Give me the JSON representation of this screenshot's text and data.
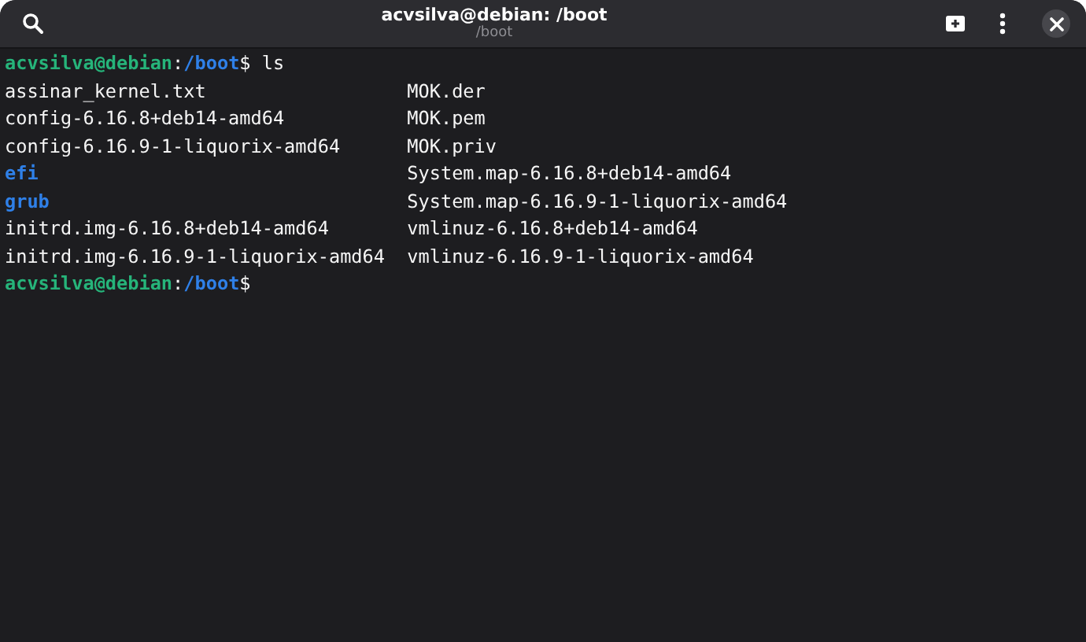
{
  "window": {
    "title": "acvsilva@debian: /boot",
    "subtitle": "/boot"
  },
  "terminal": {
    "lines": [
      {
        "kind": "prompt",
        "user_host": "acvsilva@debian",
        "separator": ":",
        "path": "/boot",
        "symbol": "$",
        "command": "ls"
      },
      {
        "kind": "listing",
        "rows": [
          [
            {
              "name": "assinar_kernel.txt",
              "kind": "file"
            },
            {
              "name": "MOK.der",
              "kind": "file"
            }
          ],
          [
            {
              "name": "config-6.16.8+deb14-amd64",
              "kind": "file"
            },
            {
              "name": "MOK.pem",
              "kind": "file"
            }
          ],
          [
            {
              "name": "config-6.16.9-1-liquorix-amd64",
              "kind": "file"
            },
            {
              "name": "MOK.priv",
              "kind": "file"
            }
          ],
          [
            {
              "name": "efi",
              "kind": "directory"
            },
            {
              "name": "System.map-6.16.8+deb14-amd64",
              "kind": "file"
            }
          ],
          [
            {
              "name": "grub",
              "kind": "directory"
            },
            {
              "name": "System.map-6.16.9-1-liquorix-amd64",
              "kind": "file"
            }
          ],
          [
            {
              "name": "initrd.img-6.16.8+deb14-amd64",
              "kind": "file"
            },
            {
              "name": "vmlinuz-6.16.8+deb14-amd64",
              "kind": "file"
            }
          ],
          [
            {
              "name": "initrd.img-6.16.9-1-liquorix-amd64",
              "kind": "file"
            },
            {
              "name": "vmlinuz-6.16.9-1-liquorix-amd64",
              "kind": "file"
            }
          ]
        ]
      },
      {
        "kind": "prompt",
        "user_host": "acvsilva@debian",
        "separator": ":",
        "path": "/boot",
        "symbol": "$"
      }
    ]
  }
}
